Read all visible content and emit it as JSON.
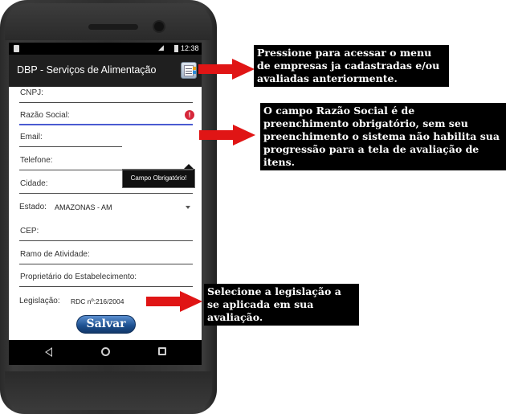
{
  "status_bar": {
    "time": "12:38"
  },
  "app_bar": {
    "title": "DBP - Serviços de Alimentação",
    "menu_icon": "company-list-icon"
  },
  "form": {
    "cnpj_label": "CNPJ:",
    "razao_social_label": "Razão Social:",
    "error_icon": "!",
    "error_tooltip": "Campo Obrigatório!",
    "email_label": "Email:",
    "telefone_label": "Telefone:",
    "cidade_label": "Cidade:",
    "estado_label": "Estado:",
    "estado_value": "AMAZONAS - AM",
    "cep_label": "CEP:",
    "ramo_label": "Ramo de Atividade:",
    "proprietario_label": "Proprietário do Estabelecimento:",
    "legislacao_label": "Legislação:",
    "legislacao_value": "RDC nº:216/2004",
    "salvar_label": "Salvar"
  },
  "callouts": {
    "menu_note": "Pressione para acessar o menu de empresas ja cadastradas e/ou avaliadas anteriormente.",
    "razao_note": "O campo Razão Social é de preenchimento obrigatório, sem seu preenchimento o sistema não habilita sua progressão para a tela de avaliação de itens.",
    "legislacao_note": "Selecione a legislação a se aplicada em sua avaliação."
  },
  "colors": {
    "arrow": "#e01515",
    "error": "#d6273a",
    "focus_underline": "#4a5bd1",
    "button": "#1c4f8f"
  }
}
